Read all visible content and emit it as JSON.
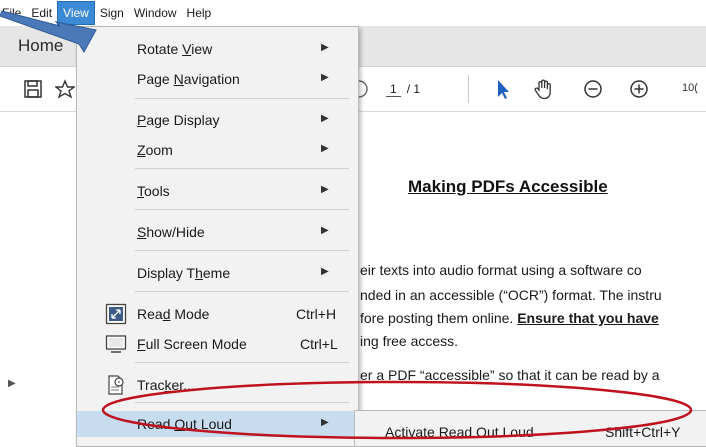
{
  "menubar": {
    "items": [
      {
        "label": "File"
      },
      {
        "label": "Edit"
      },
      {
        "label": "View"
      },
      {
        "label": "Sign"
      },
      {
        "label": "Window"
      },
      {
        "label": "Help"
      }
    ]
  },
  "tabs": {
    "home_label": "Home"
  },
  "toolbar": {
    "page_current": "1",
    "page_total": "/ 1",
    "zoom_partial": "10("
  },
  "view_menu": {
    "items": [
      {
        "label": "Rotate View",
        "mnemonic": "V",
        "submenu": true
      },
      {
        "label": "Page Navigation",
        "mnemonic": "N",
        "submenu": true
      },
      {
        "label": "Page Display",
        "mnemonic": "P",
        "submenu": true
      },
      {
        "label": "Zoom",
        "mnemonic": "Z",
        "submenu": true
      },
      {
        "label": "Tools",
        "mnemonic": "T",
        "submenu": true
      },
      {
        "label": "Show/Hide",
        "mnemonic": "S",
        "submenu": true
      },
      {
        "label": "Display Theme",
        "mnemonic": "h",
        "submenu": true
      },
      {
        "label": "Read Mode",
        "mnemonic": "d",
        "shortcut": "Ctrl+H",
        "icon": "read-mode-icon"
      },
      {
        "label": "Full Screen Mode",
        "mnemonic": "F",
        "shortcut": "Ctrl+L",
        "icon": "full-screen-icon"
      },
      {
        "label": "Tracker...",
        "mnemonic": "k",
        "icon": "tracker-icon"
      },
      {
        "label": "Read Out Loud",
        "mnemonic": "O",
        "submenu": true,
        "highlighted": true
      }
    ]
  },
  "read_out_loud_submenu": {
    "label": "Activate Read Out Loud",
    "mnemonic": "A",
    "shortcut": "Shift+Ctrl+Y"
  },
  "document": {
    "title": "Making PDFs Accessible",
    "lines": [
      "eir texts into audio format using a software co",
      "nded in an accessible (“OCR”) format. The instru",
      "fore posting them online. ",
      "ing free access.",
      "er a PDF “accessible” so that it can be read by a"
    ],
    "emphasis": "Ensure that you have"
  },
  "colors": {
    "menu_highlight": "#c8dcf0",
    "view_active": "#3a8ad6",
    "annotation_red": "#c0121e",
    "annotation_arrow": "#3f6fb0",
    "cursor_blue": "#1f5fc0"
  }
}
